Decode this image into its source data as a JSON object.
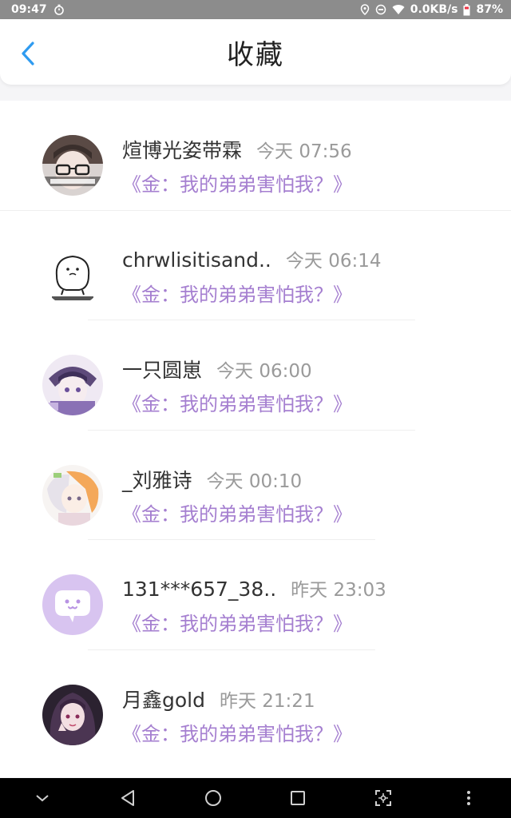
{
  "status_bar": {
    "time": "09:47",
    "net_speed": "0.0KB/s",
    "battery": "87%"
  },
  "header": {
    "title": "收藏"
  },
  "colors": {
    "accent": "#2f9bf0",
    "post_title": "#a57fd0",
    "timestamp": "#9a9a9a"
  },
  "favorites": [
    {
      "name": "煊博光姿带霖",
      "time": "今天 07:56",
      "title": "《金：我的弟弟害怕我？》",
      "avatar": "photo-avatar-glasses"
    },
    {
      "name": "chrwlisitisand..",
      "time": "今天 06:14",
      "title": "《金：我的弟弟害怕我？》",
      "avatar": "cartoon-avatar"
    },
    {
      "name": "一只圆崽",
      "time": "今天 06:00",
      "title": "《金：我的弟弟害怕我？》",
      "avatar": "anime-avatar-purple"
    },
    {
      "name": "_刘雅诗",
      "time": "今天 00:10",
      "title": "《金：我的弟弟害怕我？》",
      "avatar": "anime-avatar-orange"
    },
    {
      "name": "131***657_38..",
      "time": "昨天 23:03",
      "title": "《金：我的弟弟害怕我？》",
      "avatar": "default-chat-avatar"
    },
    {
      "name": "月鑫gold",
      "time": "昨天 21:21",
      "title": "《金：我的弟弟害怕我？》",
      "avatar": "anime-avatar-dark"
    }
  ]
}
